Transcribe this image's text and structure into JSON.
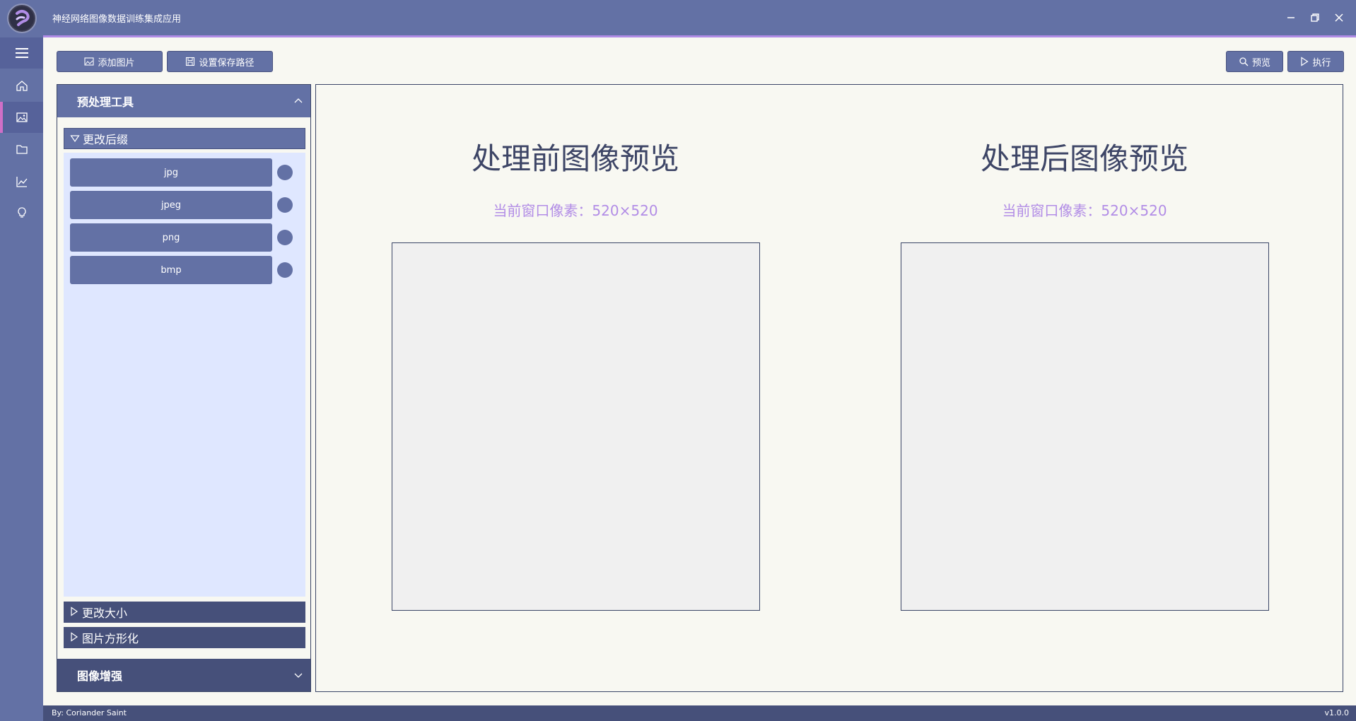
{
  "window": {
    "title": "神经网络图像数据训练集成应用",
    "controls": [
      "minimize-icon",
      "restore-icon",
      "close-icon"
    ]
  },
  "nav": {
    "items": [
      {
        "icon": "menu-icon"
      },
      {
        "icon": "home-icon"
      },
      {
        "icon": "image-icon",
        "active": true
      },
      {
        "icon": "folder-icon"
      },
      {
        "icon": "chart-icon"
      },
      {
        "icon": "lightbulb-icon"
      }
    ]
  },
  "toolbar": {
    "add_image_label": "添加图片",
    "set_save_path_label": "设置保存路径",
    "preview_label": "预览",
    "run_label": "执行"
  },
  "tools_panel": {
    "title": "预处理工具",
    "sections": {
      "change_suffix": "更改后缀",
      "resize": "更改大小",
      "square": "图片方形化"
    },
    "extensions": [
      "jpg",
      "jpeg",
      "png",
      "bmp"
    ],
    "footer_title": "图像增强"
  },
  "preview": {
    "before_title": "处理前图像预览",
    "after_title": "处理后图像预览",
    "before_pixels": "当前窗口像素：520×520",
    "after_pixels": "当前窗口像素：520×520"
  },
  "status": {
    "author": "By: Coriander Saint",
    "version": "v1.0.0"
  },
  "colors": {
    "primary": "#6371a5",
    "dark": "#46507a",
    "accent": "#b08ce6",
    "active_indicator": "#d06fc7",
    "panel_body": "#dfe7ff",
    "background": "#f8f8f2"
  }
}
